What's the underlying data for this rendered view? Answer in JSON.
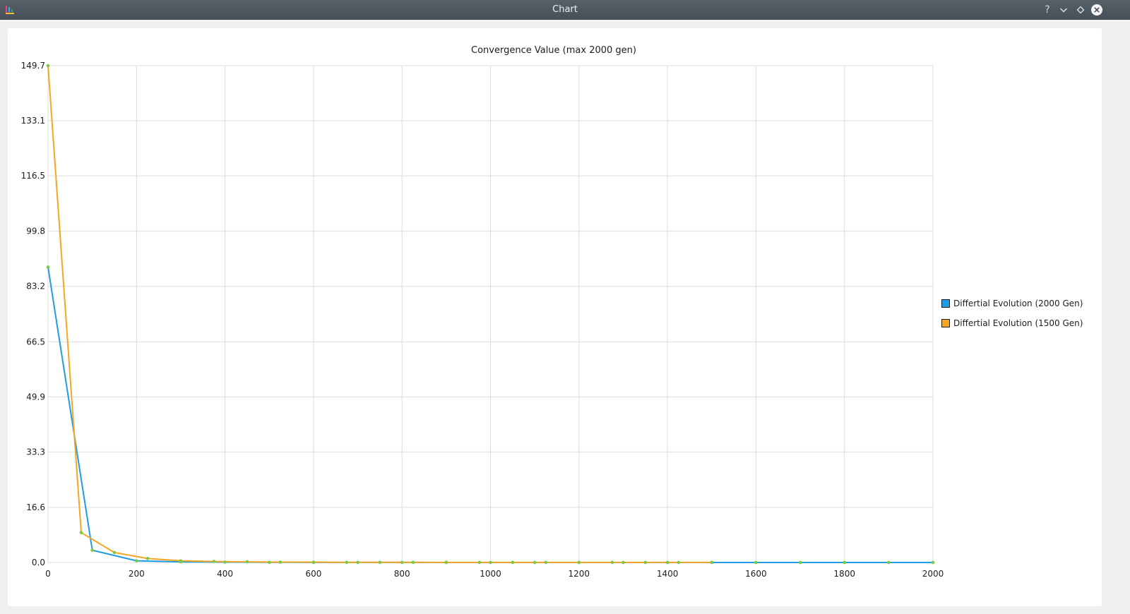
{
  "window": {
    "title": "Chart",
    "buttons": [
      {
        "name": "help-button",
        "icon": "help-icon",
        "glyph": "?"
      },
      {
        "name": "minimize-button",
        "icon": "chevron-down-icon"
      },
      {
        "name": "maximize-button",
        "icon": "diamond-icon"
      },
      {
        "name": "close-button",
        "icon": "close-icon"
      }
    ]
  },
  "chart_data": {
    "type": "line",
    "title": "Convergence Value (max 2000 gen)",
    "xlabel": "",
    "ylabel": "",
    "xlim": [
      0,
      2000
    ],
    "ylim": [
      0.0,
      149.7
    ],
    "grid": true,
    "legend_position": "right",
    "x_ticks": [
      "0",
      "200",
      "400",
      "600",
      "800",
      "1000",
      "1200",
      "1400",
      "1600",
      "1800",
      "2000"
    ],
    "y_ticks": [
      "0.0",
      "16.6",
      "33.3",
      "49.9",
      "66.5",
      "83.2",
      "99.8",
      "116.5",
      "133.1",
      "149.7"
    ],
    "series": [
      {
        "name": "Differtial Evolution (2000 Gen)",
        "color": "#1f9de3",
        "x": [
          0,
          100,
          200,
          300,
          400,
          500,
          600,
          700,
          800,
          900,
          1000,
          1100,
          1200,
          1300,
          1400,
          1500,
          1600,
          1700,
          1800,
          1900,
          2000
        ],
        "y": [
          89.0,
          3.7,
          0.5,
          0.2,
          0.1,
          0.05,
          0.03,
          0.02,
          0.02,
          0.01,
          0.01,
          0.01,
          0.01,
          0.01,
          0.01,
          0.01,
          0.01,
          0.01,
          0.01,
          0.01,
          0.01
        ]
      },
      {
        "name": "Differtial Evolution (1500 Gen)",
        "color": "#f5a623",
        "x": [
          0,
          75,
          150,
          225,
          300,
          375,
          450,
          525,
          600,
          675,
          750,
          825,
          900,
          975,
          1050,
          1125,
          1200,
          1275,
          1350,
          1425,
          1500
        ],
        "y": [
          149.7,
          9.0,
          3.0,
          1.2,
          0.5,
          0.3,
          0.2,
          0.1,
          0.1,
          0.05,
          0.05,
          0.05,
          0.03,
          0.03,
          0.03,
          0.02,
          0.02,
          0.02,
          0.02,
          0.02,
          0.02
        ]
      }
    ],
    "marker_color": "#7ac943"
  }
}
